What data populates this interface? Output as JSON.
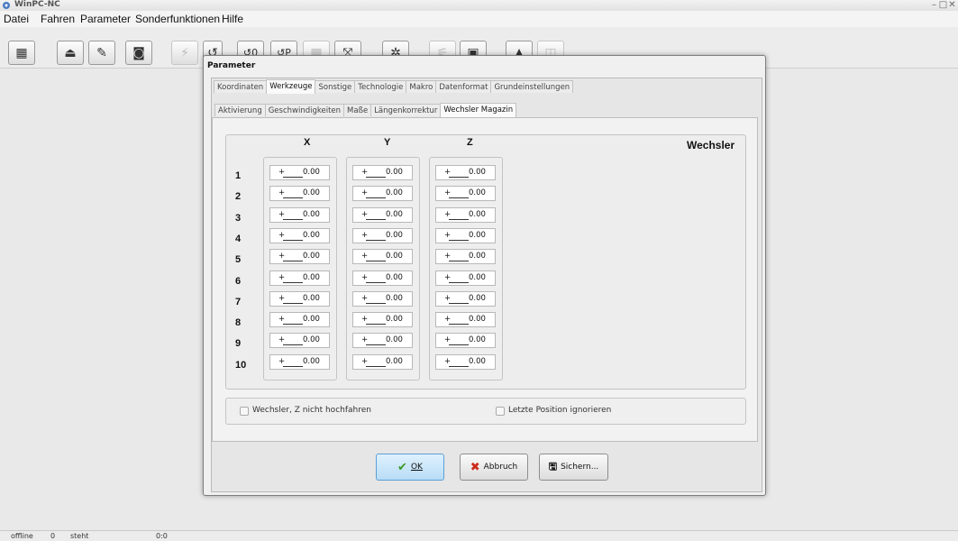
{
  "window": {
    "title": "WinPC-NC",
    "controls": [
      "–",
      "□",
      "✕"
    ]
  },
  "menu": [
    "Datei",
    "Fahren",
    "Parameter",
    "Sonderfunktionen",
    "Hilfe"
  ],
  "toolbar": {
    "icons": [
      "clapperboard-icon",
      "spindle-icon",
      "pen-icon",
      "camera-icon",
      "lightning-icon",
      "rotate-icon",
      "rotate-zero-icon",
      "rotate-p-icon",
      "grid-icon",
      "axes-icon",
      "sun-icon",
      "tool-icon",
      "monitor-icon",
      "warning-icon",
      "book-icon"
    ],
    "glyphs": [
      "▦",
      "⏏",
      "✎",
      "◙",
      "⚡",
      "↺",
      "↺0",
      "↺P",
      "▦",
      "⤧",
      "✲",
      "⚟",
      "▣",
      "▲",
      "◫"
    ],
    "partial_labels": [
      "0",
      "P"
    ]
  },
  "dialog": {
    "title": "Parameter",
    "tabs": [
      "Koordinaten",
      "Werkzeuge",
      "Sonstige",
      "Technologie",
      "Makro",
      "Datenformat",
      "Grundeinstellungen"
    ],
    "active_tab": "Werkzeuge",
    "subtabs": [
      "Aktivierung",
      "Geschwindigkeiten",
      "Maße",
      "Längenkorrektur",
      "Wechsler Magazin"
    ],
    "active_subtab": "Wechsler Magazin",
    "section_title": "Wechsler",
    "columns": [
      "X",
      "Y",
      "Z"
    ],
    "rows": [
      "1",
      "2",
      "3",
      "4",
      "5",
      "6",
      "7",
      "8",
      "9",
      "10"
    ],
    "cell": {
      "sign": "+",
      "value": "0.00"
    },
    "values": {
      "X": [
        "0.00",
        "0.00",
        "0.00",
        "0.00",
        "0.00",
        "0.00",
        "0.00",
        "0.00",
        "0.00",
        "0.00"
      ],
      "Y": [
        "0.00",
        "0.00",
        "0.00",
        "0.00",
        "0.00",
        "0.00",
        "0.00",
        "0.00",
        "0.00",
        "0.00"
      ],
      "Z": [
        "0.00",
        "0.00",
        "0.00",
        "0.00",
        "0.00",
        "0.00",
        "0.00",
        "0.00",
        "0.00",
        "0.00"
      ]
    },
    "options": {
      "no_z_up": {
        "label": "Wechsler, Z nicht hochfahren",
        "checked": false
      },
      "ignore_last": {
        "label": "Letzte Position ignorieren",
        "checked": false
      }
    },
    "buttons": {
      "ok": "OK",
      "cancel": "Abbruch",
      "save": "Sichern..."
    }
  },
  "status": [
    "offline",
    "0",
    "steht",
    "",
    "",
    "0:0"
  ],
  "colors": {
    "ok_accent": "#3a9a2a",
    "cancel_x": "#cc2a1a",
    "primary_btn": "#cfe7fa"
  }
}
